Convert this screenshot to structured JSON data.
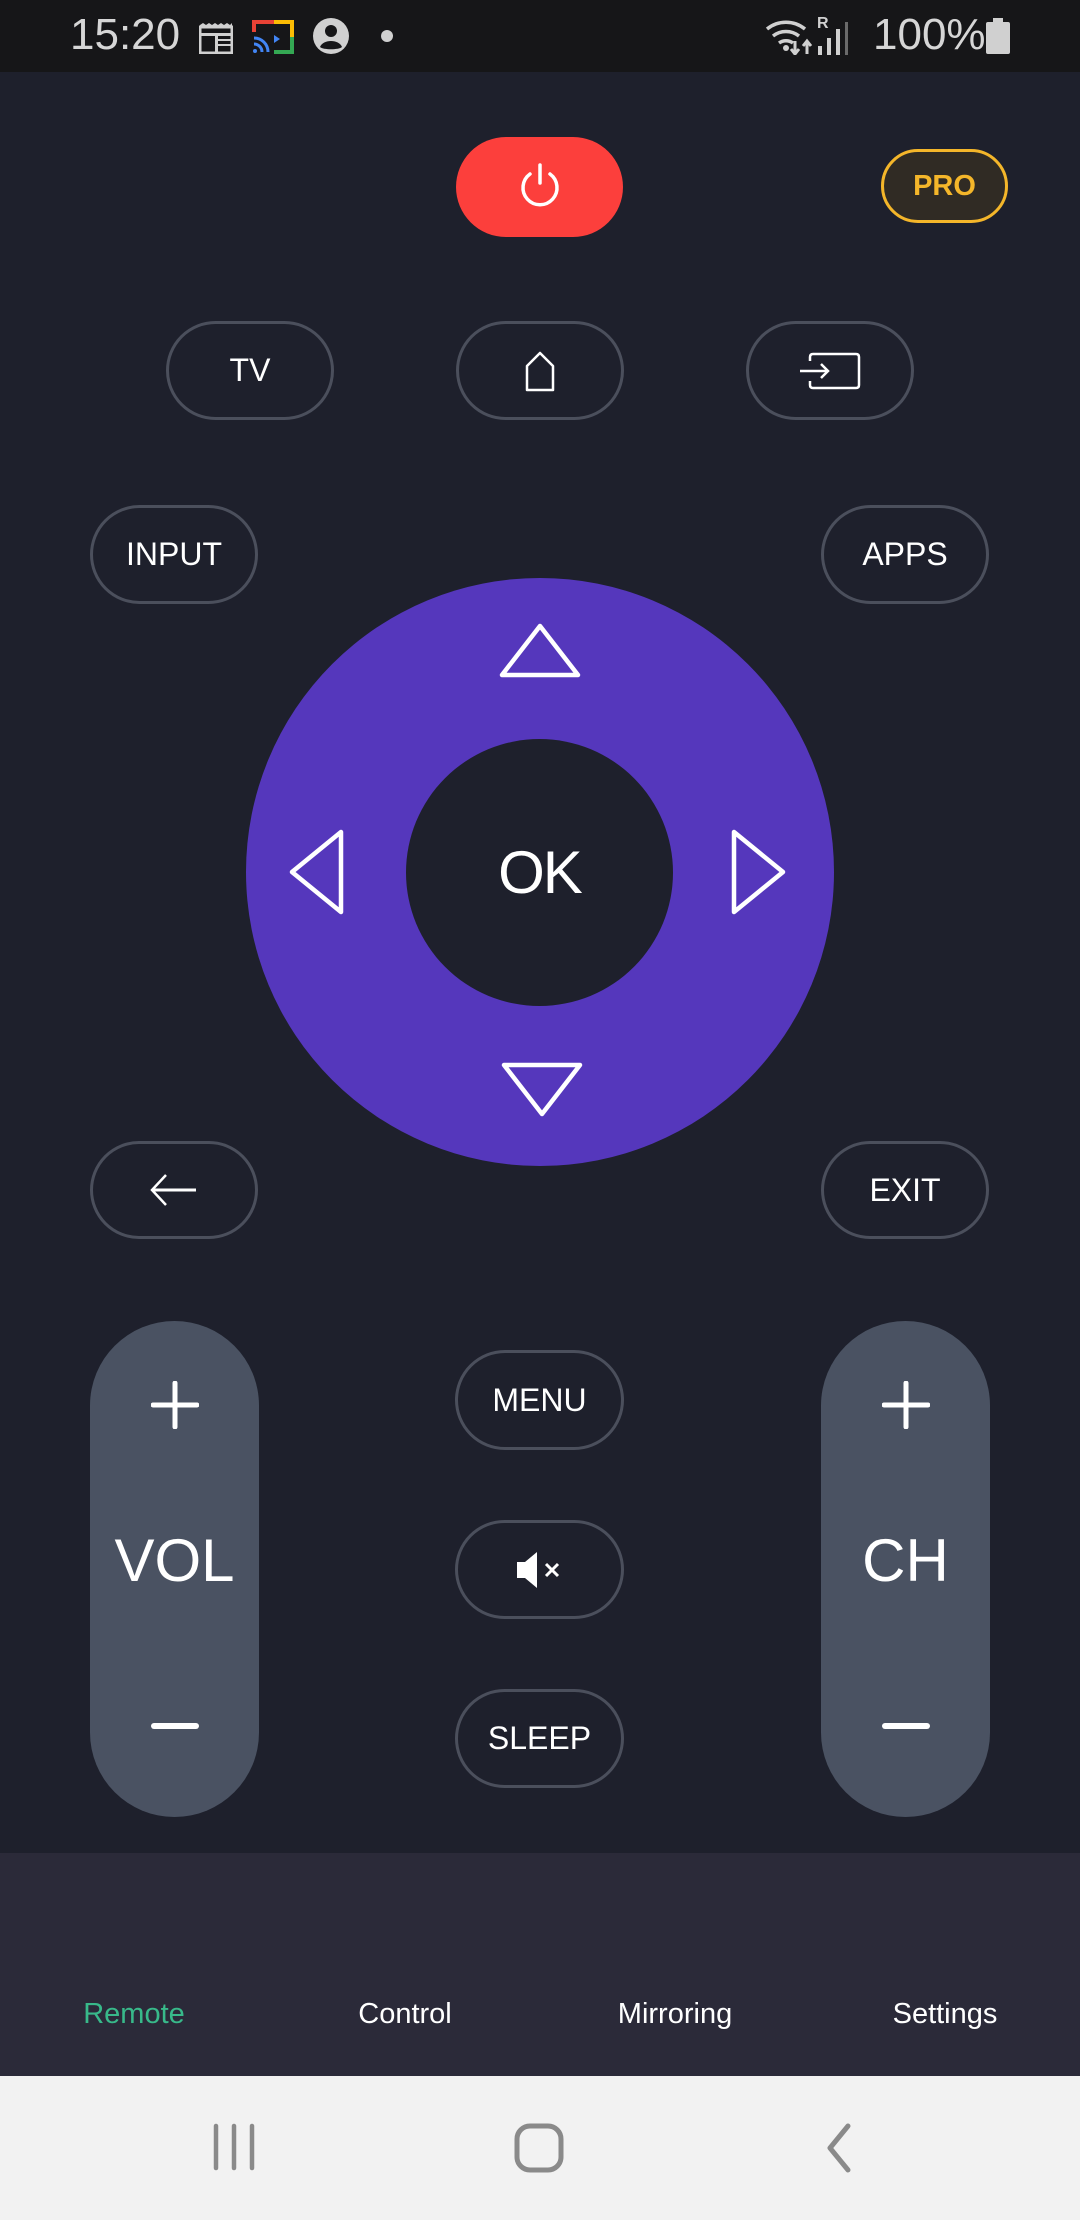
{
  "status_bar": {
    "time": "15:20",
    "notification_icons": [
      "calendar-news-icon",
      "cast-icon",
      "account-icon",
      "dot-icon"
    ],
    "system_icons": [
      "wifi-data-icon",
      "signal-roaming-icon"
    ],
    "roaming_label": "R",
    "battery_percent": "100%",
    "battery_level": 1.0
  },
  "remote": {
    "power": {
      "icon": "power-icon",
      "color": "#fc3f3c"
    },
    "pro_badge": {
      "label": "PRO",
      "color": "#f4b62a"
    },
    "row1": [
      {
        "id": "tv",
        "label": "TV"
      },
      {
        "id": "home",
        "icon": "home-icon"
      },
      {
        "id": "source",
        "icon": "input-source-icon"
      }
    ],
    "input_label": "INPUT",
    "apps_label": "APPS",
    "dpad": {
      "ok_label": "OK",
      "accent_color": "#5537bc",
      "directions": [
        "up",
        "down",
        "left",
        "right"
      ]
    },
    "back": {
      "icon": "back-arrow-icon"
    },
    "exit_label": "EXIT",
    "volume": {
      "label": "VOL",
      "plus": "+",
      "minus": "−"
    },
    "channel": {
      "label": "CH",
      "plus": "+",
      "minus": "−"
    },
    "menu_label": "MENU",
    "mute": {
      "icon": "mute-icon"
    },
    "sleep_label": "SLEEP"
  },
  "tabs": {
    "active_color": "#38b98a",
    "items": [
      {
        "label": "Remote",
        "active": true
      },
      {
        "label": "Control",
        "active": false
      },
      {
        "label": "Mirroring",
        "active": false
      },
      {
        "label": "Settings",
        "active": false
      }
    ]
  },
  "nav_bar": {
    "buttons": [
      "recent-apps",
      "home",
      "back"
    ]
  }
}
